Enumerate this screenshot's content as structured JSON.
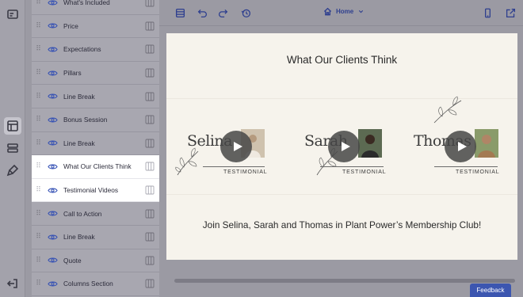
{
  "sections": [
    {
      "label": "What's Included",
      "selected": false
    },
    {
      "label": "Price",
      "selected": false
    },
    {
      "label": "Expectations",
      "selected": false
    },
    {
      "label": "Pillars",
      "selected": false
    },
    {
      "label": "Line Break",
      "selected": false
    },
    {
      "label": "Bonus Session",
      "selected": false
    },
    {
      "label": "Line Break",
      "selected": false
    },
    {
      "label": "What Our Clients Think",
      "selected": true
    },
    {
      "label": "Testimonial Videos",
      "selected": true
    },
    {
      "label": "Call to Action",
      "selected": false
    },
    {
      "label": "Line Break",
      "selected": false
    },
    {
      "label": "Quote",
      "selected": false
    },
    {
      "label": "Columns Section",
      "selected": false
    }
  ],
  "toolbar": {
    "page_select": "Home"
  },
  "canvas": {
    "title": "What Our Clients Think",
    "testimonials": [
      {
        "name": "Selina",
        "tag": "TESTIMONIAL"
      },
      {
        "name": "Sarah",
        "tag": "TESTIMONIAL"
      },
      {
        "name": "Thomas",
        "tag": "TESTIMONIAL"
      }
    ],
    "cta": "Join Selina, Sarah and Thomas in Plant Power’s Membership Club!"
  },
  "feedback_label": "Feedback",
  "colors": {
    "accent": "#2e3f8f",
    "feedback": "#3c56b0",
    "canvas_bg": "#f6f3ec"
  }
}
